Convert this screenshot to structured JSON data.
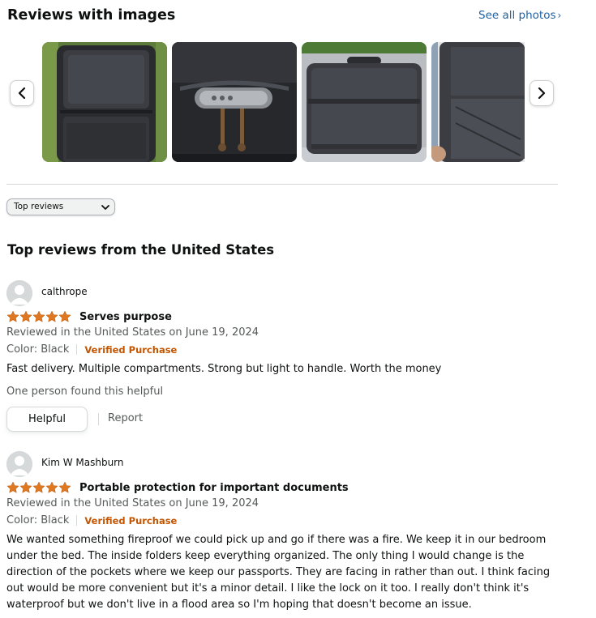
{
  "images_section": {
    "heading": "Reviews with images",
    "see_all_label": "See all photos",
    "see_all_chevron": "›",
    "thumbnails": [
      {
        "icon": "case-interior-photo"
      },
      {
        "icon": "combination-lock-photo"
      },
      {
        "icon": "case-exterior-photo"
      },
      {
        "icon": "case-side-photo"
      }
    ],
    "prev_icon": "chevron-left-icon",
    "next_icon": "chevron-right-icon"
  },
  "sort": {
    "selected": "Top reviews"
  },
  "reviews_heading": "Top reviews from the United States",
  "colors": {
    "link": "#2162a1",
    "star": "#de7921",
    "verified": "#c45500",
    "muted": "#565959"
  },
  "reviews": [
    {
      "author": "calthrope",
      "rating": 5,
      "title": "Serves purpose",
      "date": "Reviewed in the United States on June 19, 2024",
      "color": "Color: Black",
      "verified": "Verified Purchase",
      "body": "Fast delivery. Multiple compartments. Strong but light to handle. Worth the money",
      "helpful_count_text": "One person found this helpful",
      "helpful_label": "Helpful",
      "report_label": "Report"
    },
    {
      "author": "Kim W Mashburn",
      "rating": 5,
      "title": "Portable protection for important documents",
      "date": "Reviewed in the United States on June 19, 2024",
      "color": "Color: Black",
      "verified": "Verified Purchase",
      "body": "We wanted something fireproof we could pick up and go if there was a fire. We keep it in our bedroom under the bed. The inside folders keep everything organized. The only thing I would change is the direction of the pockets where we keep our passports. They are facing in rather than out. I think facing out would be more convenient but it's a minor detail. I like the lock on it too. I really don't think it's waterproof but we don't live in a flood area so I'm hoping that doesn't become an issue."
    }
  ]
}
